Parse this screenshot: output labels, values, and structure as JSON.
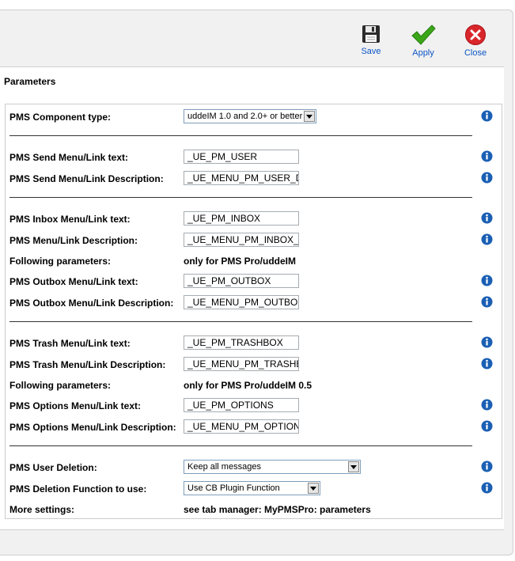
{
  "toolbar": {
    "save_label": "Save",
    "apply_label": "Apply",
    "close_label": "Close"
  },
  "params_title": "Parameters",
  "rows": {
    "component_type": {
      "label": "PMS Component type:",
      "value": "uddeIM 1.0 and 2.0+ or better"
    },
    "send_text": {
      "label": "PMS Send Menu/Link text:",
      "value": "_UE_PM_USER"
    },
    "send_desc": {
      "label": "PMS Send Menu/Link Description:",
      "value": "_UE_MENU_PM_USER_DESC"
    },
    "inbox_text": {
      "label": "PMS Inbox Menu/Link text:",
      "value": "_UE_PM_INBOX"
    },
    "menu_desc": {
      "label": "PMS Menu/Link Description:",
      "value": "_UE_MENU_PM_INBOX_DESC"
    },
    "following_1": {
      "label": "Following parameters:",
      "value": "only for PMS Pro/uddeIM"
    },
    "outbox_text": {
      "label": "PMS Outbox Menu/Link text:",
      "value": "_UE_PM_OUTBOX"
    },
    "outbox_desc": {
      "label": "PMS Outbox Menu/Link Description:",
      "value": "_UE_MENU_PM_OUTBOX_DESC"
    },
    "trash_text": {
      "label": "PMS Trash Menu/Link text:",
      "value": "_UE_PM_TRASHBOX"
    },
    "trash_desc": {
      "label": "PMS Trash Menu/Link Description:",
      "value": "_UE_MENU_PM_TRASHBOX_DESC"
    },
    "following_2": {
      "label": "Following parameters:",
      "value": "only for PMS Pro/uddeIM 0.5"
    },
    "options_text": {
      "label": "PMS Options Menu/Link text:",
      "value": "_UE_PM_OPTIONS"
    },
    "options_desc": {
      "label": "PMS Options Menu/Link Description:",
      "value": "_UE_MENU_PM_OPTIONS_DESC"
    },
    "user_deletion": {
      "label": "PMS User Deletion:",
      "value": "Keep all messages"
    },
    "deletion_function": {
      "label": "PMS Deletion Function to use:",
      "value": "Use CB Plugin Function"
    },
    "more_settings": {
      "label": "More settings:",
      "value": "see tab manager: MyPMSPro: parameters"
    }
  },
  "colors": {
    "info_blue": "#1a5fb4",
    "apply_green": "#3aa618",
    "close_red": "#d9262b",
    "toolbar_link": "#0b55c4"
  },
  "icons": [
    "save-icon",
    "apply-icon",
    "close-icon",
    "info-icon",
    "dropdown-arrow-icon"
  ]
}
